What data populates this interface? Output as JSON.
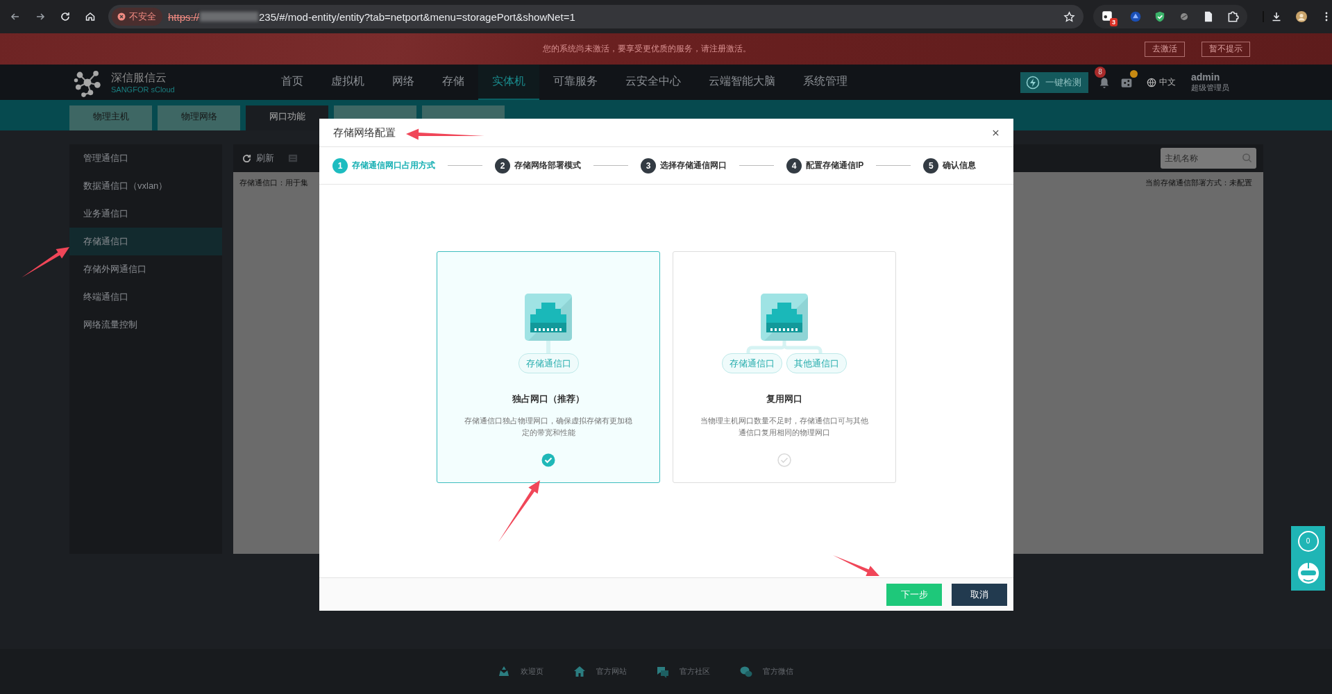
{
  "browser": {
    "security_label": "不安全",
    "url_scheme": "https://",
    "url_rest": "235/#/mod-entity/entity?tab=netport&menu=storagePort&showNet=1",
    "extension_badge": "3"
  },
  "banner": {
    "message": "您的系统尚未激活，要享受更优质的服务，请注册激活。",
    "buttons": [
      "去激活",
      "暂不提示"
    ]
  },
  "header": {
    "logo_name": "深信服信云",
    "logo_sub": "SANGFOR sCloud",
    "nav": [
      {
        "label": "首页",
        "selected": false
      },
      {
        "label": "虚拟机",
        "selected": false
      },
      {
        "label": "网络",
        "selected": false
      },
      {
        "label": "存储",
        "selected": false
      },
      {
        "label": "实体机",
        "selected": true
      },
      {
        "label": "可靠服务",
        "selected": false
      },
      {
        "label": "云安全中心",
        "selected": false
      },
      {
        "label": "云端智能大脑",
        "selected": false
      },
      {
        "label": "系统管理",
        "selected": false
      }
    ],
    "check_button": "一键检测",
    "notification_count": "8",
    "language": "中文",
    "user": "admin",
    "role": "超级管理员"
  },
  "subtabs": [
    {
      "label": "物理主机",
      "selected": false
    },
    {
      "label": "物理网络",
      "selected": false
    },
    {
      "label": "网口功能",
      "selected": true
    }
  ],
  "sidebar": [
    {
      "label": "管理通信口",
      "selected": false
    },
    {
      "label": "数据通信口（vxlan）",
      "selected": false
    },
    {
      "label": "业务通信口",
      "selected": false
    },
    {
      "label": "存储通信口",
      "selected": true
    },
    {
      "label": "存储外网通信口",
      "selected": false
    },
    {
      "label": "终端通信口",
      "selected": false
    },
    {
      "label": "网络流量控制",
      "selected": false
    }
  ],
  "toolbar": {
    "refresh": "刷新",
    "search_placeholder": "主机名称"
  },
  "content": {
    "info": "存储通信口：用于集",
    "status": "当前存储通信部署方式：未配置"
  },
  "modal": {
    "title": "存储网络配置",
    "steps": [
      {
        "number": "1",
        "label": "存储通信网口占用方式",
        "selected": true
      },
      {
        "number": "2",
        "label": "存储网络部署模式",
        "selected": false
      },
      {
        "number": "3",
        "label": "选择存储通信网口",
        "selected": false
      },
      {
        "number": "4",
        "label": "配置存储通信IP",
        "selected": false
      },
      {
        "number": "5",
        "label": "确认信息",
        "selected": false
      }
    ],
    "options": [
      {
        "kind": "single",
        "tags": [
          "存储通信口"
        ],
        "title": "独占网口（推荐）",
        "description": "存储通信口独占物理网口，确保虚拟存储有更加稳定的带宽和性能",
        "selected": true
      },
      {
        "kind": "shared",
        "tags": [
          "存储通信口",
          "其他通信口"
        ],
        "title": "复用网口",
        "description": "当物理主机网口数量不足时，存储通信口可与其他通信口复用相同的物理网口",
        "selected": false
      }
    ],
    "next_button": "下一步",
    "cancel_button": "取消"
  },
  "footer": {
    "links": [
      "欢迎页",
      "官方网站",
      "官方社区",
      "官方微信"
    ]
  },
  "float_panel": {
    "count": "0"
  }
}
